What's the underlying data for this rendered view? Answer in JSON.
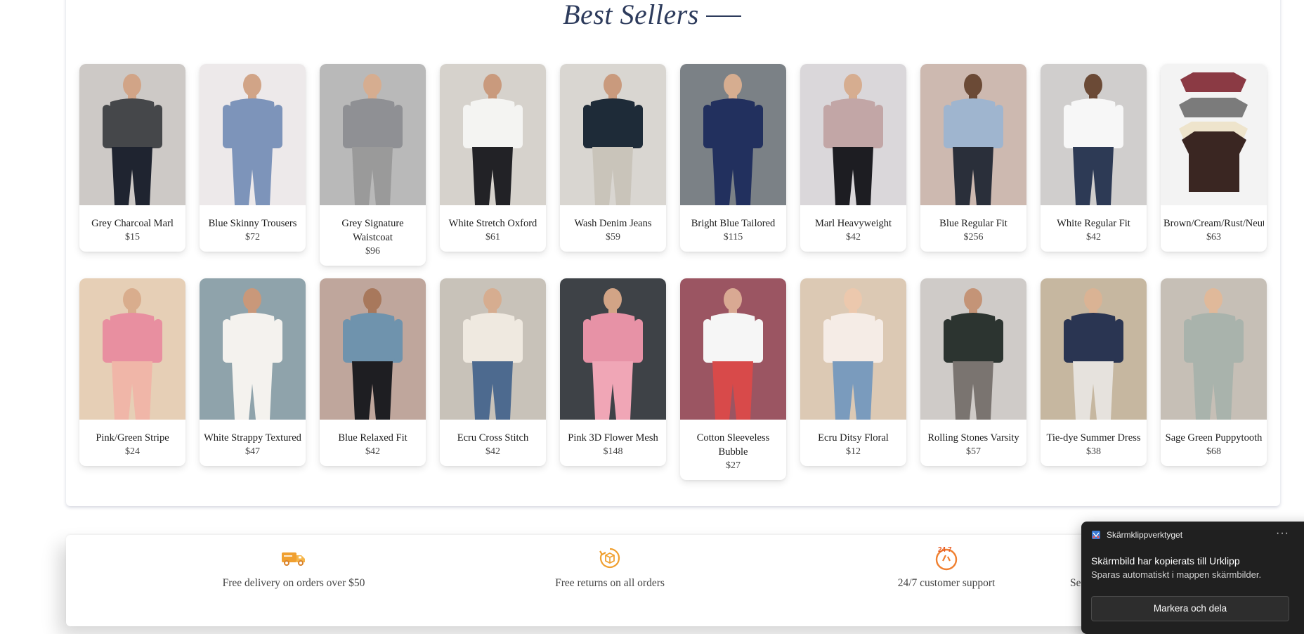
{
  "section": {
    "title": "Best Sellers"
  },
  "products_row1": [
    {
      "name": "Grey Charcoal Marl",
      "price": "$15"
    },
    {
      "name": "Blue Skinny Trousers",
      "price": "$72"
    },
    {
      "name": "Grey Signature Waistcoat",
      "price": "$96"
    },
    {
      "name": "White Stretch Oxford",
      "price": "$61"
    },
    {
      "name": "Wash Denim Jeans",
      "price": "$59"
    },
    {
      "name": "Bright Blue Tailored",
      "price": "$115"
    },
    {
      "name": "Marl Heavyweight",
      "price": "$42"
    },
    {
      "name": "Blue Regular Fit",
      "price": "$256"
    },
    {
      "name": "White Regular Fit",
      "price": "$42"
    },
    {
      "name": "Brown/Cream/Rust/Neutral",
      "price": "$63"
    }
  ],
  "products_row2": [
    {
      "name": "Pink/Green Stripe",
      "price": "$24"
    },
    {
      "name": "White Strappy Textured",
      "price": "$47"
    },
    {
      "name": "Blue Relaxed Fit",
      "price": "$42"
    },
    {
      "name": "Ecru Cross Stitch",
      "price": "$42"
    },
    {
      "name": "Pink 3D Flower Mesh",
      "price": "$148"
    },
    {
      "name": "Cotton Sleeveless Bubble",
      "price": "$27"
    },
    {
      "name": "Ecru Ditsy Floral",
      "price": "$12"
    },
    {
      "name": "Rolling Stones Varsity",
      "price": "$57"
    },
    {
      "name": "Tie-dye Summer Dress",
      "price": "$38"
    },
    {
      "name": "Sage Green Puppytooth",
      "price": "$68"
    }
  ],
  "benefits": [
    {
      "icon": "delivery-truck-icon",
      "text": "Free delivery on orders over $50"
    },
    {
      "icon": "returns-box-icon",
      "text": "Free returns on all orders"
    },
    {
      "icon": "support-24-7-icon",
      "text": "24/7 customer support"
    },
    {
      "icon": "secure-icon",
      "text": "Se"
    }
  ],
  "toast": {
    "app_name": "Skärmklippverktyget",
    "more": "···",
    "title": "Skärmbild har kopierats till Urklipp",
    "subtitle": "Sparas automatiskt i mappen skärmbilder.",
    "action": "Markera och dela"
  },
  "colors": {
    "accent_orange": "#f0a030",
    "title_navy": "#2d3b5c",
    "toast_bg": "#202020"
  },
  "photo_palette_row1": [
    {
      "bg": "#cdc9c6",
      "top": "#45474a",
      "bottom": "#1f2430",
      "skin": "#d1a487"
    },
    {
      "bg": "#ede9ea",
      "top": "#7d94ba",
      "bottom": "#7d94ba",
      "skin": "#d1a487"
    },
    {
      "bg": "#b9b9b9",
      "top": "#8f9094",
      "bottom": "#9a9a9a",
      "skin": "#d6ad90"
    },
    {
      "bg": "#d6d2cc",
      "top": "#f4f4f2",
      "bottom": "#222226",
      "skin": "#c99a7d"
    },
    {
      "bg": "#d9d6d1",
      "top": "#1e2b38",
      "bottom": "#c9c4ba",
      "skin": "#c99a7d"
    },
    {
      "bg": "#7b8186",
      "top": "#22305e",
      "bottom": "#22305e",
      "skin": "#d6ad90"
    },
    {
      "bg": "#dad7da",
      "top": "#c2a6a6",
      "bottom": "#1d1d22",
      "skin": "#d6ad90"
    },
    {
      "bg": "#cdb9b0",
      "top": "#9fb5cf",
      "bottom": "#2a2f3a",
      "skin": "#6b4a36"
    },
    {
      "bg": "#d0cecd",
      "top": "#f7f7f7",
      "bottom": "#2d3a55",
      "skin": "#6b4a36"
    },
    {
      "bg": "#f3f3f3",
      "top": "#3a2622",
      "bottom": "#3a2622",
      "skin": "#f3f3f3"
    }
  ],
  "photo_palette_row2": [
    {
      "bg": "#e6cfb6",
      "top": "#e88fa0",
      "bottom": "#f0b6a8",
      "skin": "#d9ad8d"
    },
    {
      "bg": "#8fa3ab",
      "top": "#f4f2ee",
      "bottom": "#f4f2ee",
      "skin": "#c9987a"
    },
    {
      "bg": "#bfa69c",
      "top": "#6f93ad",
      "bottom": "#1e1e22",
      "skin": "#a8785c"
    },
    {
      "bg": "#c8c2b9",
      "top": "#efe9e0",
      "bottom": "#4d6a8f",
      "skin": "#d6ad90"
    },
    {
      "bg": "#3e4247",
      "top": "#e792a6",
      "bottom": "#f0a6b6",
      "skin": "#d2a486"
    },
    {
      "bg": "#9b5562",
      "top": "#f6f6f6",
      "bottom": "#d84a4a",
      "skin": "#d9a993"
    },
    {
      "bg": "#dcc9b4",
      "top": "#f5ece6",
      "bottom": "#7a9bbd",
      "skin": "#ecc8ad"
    },
    {
      "bg": "#cfcbc8",
      "top": "#2c3430",
      "bottom": "#7a7470",
      "skin": "#c49477"
    },
    {
      "bg": "#c6b7a0",
      "top": "#2a3552",
      "bottom": "#e6e2dd",
      "skin": "#dab394"
    },
    {
      "bg": "#c6bfb6",
      "top": "#a9b3ac",
      "bottom": "#a9b3ac",
      "skin": "#e0b99a"
    }
  ]
}
